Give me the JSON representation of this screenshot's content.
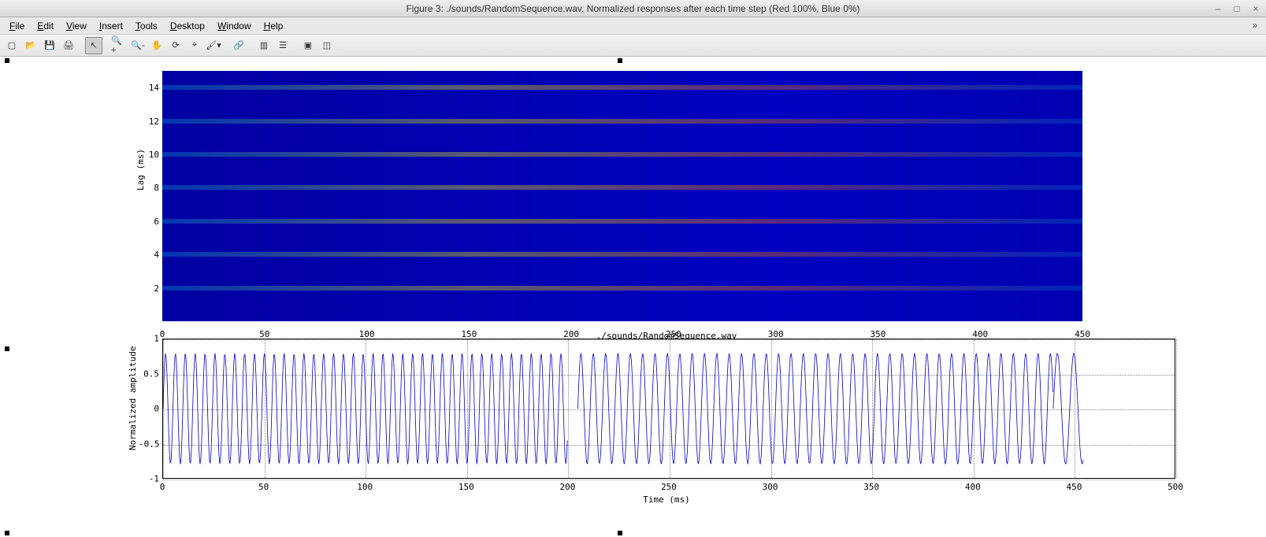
{
  "window": {
    "title": "Figure 3: ./sounds/RandomSequence.wav. Normalized responses after each time step (Red 100%, Blue 0%)",
    "controls": {
      "min": "–",
      "max": "□",
      "close": "×"
    }
  },
  "menubar": {
    "items": [
      "File",
      "Edit",
      "View",
      "Insert",
      "Tools",
      "Desktop",
      "Window",
      "Help"
    ]
  },
  "toolbar": {
    "buttons": [
      {
        "name": "new-figure-icon",
        "glyph": "▢"
      },
      {
        "name": "open-icon",
        "glyph": "📂"
      },
      {
        "name": "save-icon",
        "glyph": "💾"
      },
      {
        "name": "print-icon",
        "glyph": "🖨"
      },
      {
        "sep": true
      },
      {
        "name": "edit-plot-icon",
        "glyph": "↖",
        "active": true
      },
      {
        "sep": true
      },
      {
        "name": "zoom-in-icon",
        "glyph": "🔍+"
      },
      {
        "name": "zoom-out-icon",
        "glyph": "🔍-"
      },
      {
        "name": "pan-icon",
        "glyph": "✋"
      },
      {
        "name": "rotate3d-icon",
        "glyph": "⟳"
      },
      {
        "name": "data-cursor-icon",
        "glyph": "⌖"
      },
      {
        "name": "brush-icon",
        "glyph": "🖌▾"
      },
      {
        "sep": true
      },
      {
        "name": "link-icon",
        "glyph": "🔗"
      },
      {
        "sep": true
      },
      {
        "name": "colorbar-icon",
        "glyph": "▥"
      },
      {
        "name": "legend-icon",
        "glyph": "☰"
      },
      {
        "sep": true
      },
      {
        "name": "hide-plot-tools-icon",
        "glyph": "▣"
      },
      {
        "name": "show-plot-tools-icon",
        "glyph": "◫"
      }
    ],
    "figure_menu_glyph": "»"
  },
  "chart_data": [
    {
      "type": "heatmap",
      "title": "",
      "ylabel": "Lag (ms)",
      "y_ticks": [
        2,
        4,
        6,
        8,
        10,
        12,
        14
      ],
      "x_ticks": [
        0,
        50,
        100,
        150,
        200,
        250,
        300,
        350,
        400,
        450
      ],
      "xlim": [
        0,
        450
      ],
      "ylim": [
        0,
        15
      ],
      "mid_label": "./sounds/RandomSequence.wav",
      "band_lags_ms": [
        2,
        4,
        6,
        8,
        10,
        12,
        14
      ]
    },
    {
      "type": "line",
      "title": "",
      "xlabel": "Time (ms)",
      "ylabel": "Normalized amplitude",
      "y_ticks": [
        -1,
        -0.5,
        0,
        0.5,
        1
      ],
      "x_ticks": [
        0,
        50,
        100,
        150,
        200,
        250,
        300,
        350,
        400,
        450,
        500
      ],
      "xlim": [
        0,
        500
      ],
      "ylim": [
        -1,
        1
      ],
      "segments": [
        {
          "x_start": 0,
          "x_end": 200,
          "amplitude": 0.8,
          "freq": 0.5
        },
        {
          "x_start": 205,
          "x_end": 440,
          "amplitude": 0.8,
          "freq": 0.4
        },
        {
          "x_start": 440,
          "x_end": 455,
          "amplitude": 0.8,
          "freq": 0.3
        }
      ]
    }
  ]
}
